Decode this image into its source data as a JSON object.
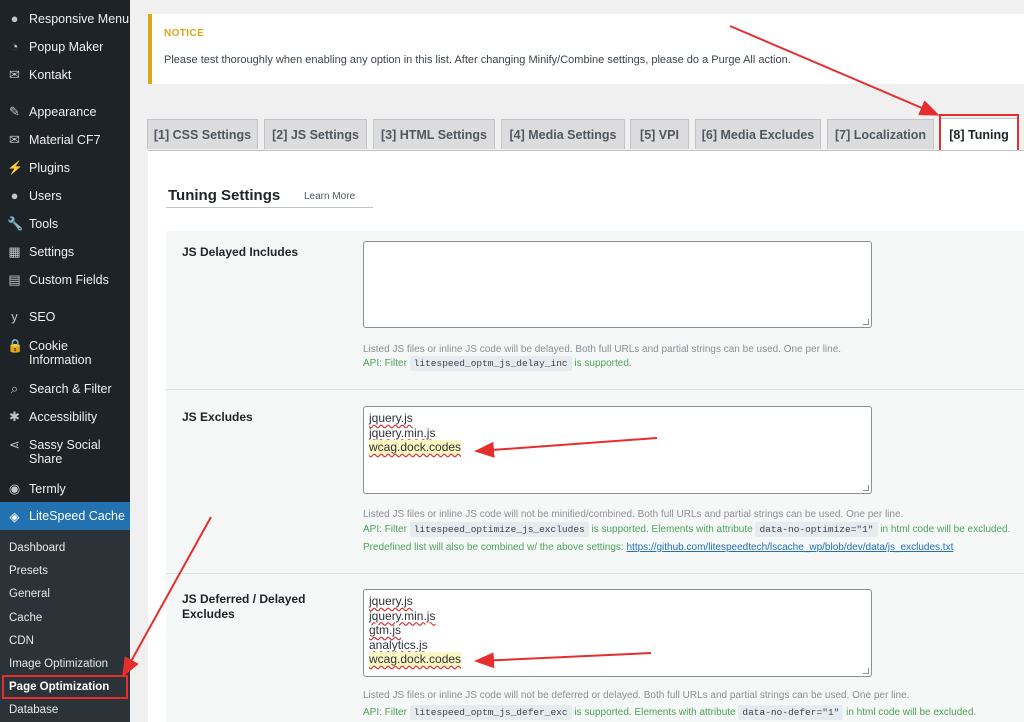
{
  "sidebar": {
    "items": [
      {
        "label": "Responsive Menu",
        "icon": "circle-icon"
      },
      {
        "label": "Popup Maker",
        "icon": "popup-icon"
      },
      {
        "label": "Kontakt",
        "icon": "mail-icon"
      },
      {
        "label": "Appearance",
        "icon": "brush-icon"
      },
      {
        "label": "Material CF7",
        "icon": "mail-icon"
      },
      {
        "label": "Plugins",
        "icon": "plug-icon"
      },
      {
        "label": "Users",
        "icon": "user-icon"
      },
      {
        "label": "Tools",
        "icon": "wrench-icon"
      },
      {
        "label": "Settings",
        "icon": "settings-icon"
      },
      {
        "label": "Custom Fields",
        "icon": "grid-icon"
      },
      {
        "label": "SEO",
        "icon": "yoast-icon"
      },
      {
        "label": "Cookie Information",
        "icon": "lock-icon"
      },
      {
        "label": "Search & Filter",
        "icon": "search-icon"
      },
      {
        "label": "Accessibility",
        "icon": "accessibility-icon"
      },
      {
        "label": "Sassy Social Share",
        "icon": "share-icon"
      },
      {
        "label": "Termly",
        "icon": "termly-icon"
      }
    ],
    "active": {
      "label": "LiteSpeed Cache",
      "icon": "diamond-icon"
    },
    "submenu": [
      "Dashboard",
      "Presets",
      "General",
      "Cache",
      "CDN",
      "Image Optimization",
      "Page Optimization",
      "Database"
    ],
    "submenu_active": "Page Optimization"
  },
  "notice": {
    "title": "NOTICE",
    "text": "Please test thoroughly when enabling any option in this list. After changing Minify/Combine settings, please do a Purge All action."
  },
  "tabs": [
    "[1] CSS Settings",
    "[2] JS Settings",
    "[3] HTML Settings",
    "[4] Media Settings",
    "[5] VPI",
    "[6] Media Excludes",
    "[7] Localization",
    "[8] Tuning"
  ],
  "active_tab": "[8] Tuning",
  "panel": {
    "title": "Tuning Settings",
    "learn_more": "Learn More"
  },
  "settings": {
    "delayed": {
      "label": "JS Delayed Includes",
      "lines": [],
      "desc": "Listed JS files or inline JS code will be delayed. Both full URLs and partial strings can be used. One per line.",
      "api_prefix": "API: Filter",
      "api_code": "litespeed_optm_js_delay_inc",
      "api_suffix": "is supported."
    },
    "excludes": {
      "label": "JS Excludes",
      "lines": [
        "jquery.js",
        "jquery.min.js",
        "wcag.dock.codes"
      ],
      "desc": "Listed JS files or inline JS code will not be minified/combined. Both full URLs and partial strings can be used. One per line.",
      "api_prefix": "API: Filter",
      "api_code": "litespeed_optimize_js_excludes",
      "api_mid": "is supported. Elements with attribute",
      "api_code2": "data-no-optimize=\"1\"",
      "api_suffix": "in html code will be excluded.",
      "predefined_text": "Predefined list will also be combined w/ the above settings:",
      "predefined_link": "https://github.com/litespeedtech/lscache_wp/blob/dev/data/js_excludes.txt"
    },
    "deferred": {
      "label": "JS Deferred / Delayed Excludes",
      "lines": [
        "jquery.js",
        "jquery.min.js",
        "gtm.js",
        "analytics.js",
        "wcag.dock.codes"
      ],
      "desc": "Listed JS files or inline JS code will not be deferred or delayed. Both full URLs and partial strings can be used. One per line.",
      "api_prefix": "API: Filter",
      "api_code": "litespeed_optm_js_defer_exc",
      "api_mid": "is supported. Elements with attribute",
      "api_code2": "data-no-defer=\"1\"",
      "api_suffix": "in html code will be excluded."
    }
  },
  "colors": {
    "sidebar_bg": "#1d2327",
    "active_bg": "#2271b1",
    "notice_border": "#dba617",
    "annotation_red": "#e62e2e",
    "api_green": "#4aa45a"
  }
}
